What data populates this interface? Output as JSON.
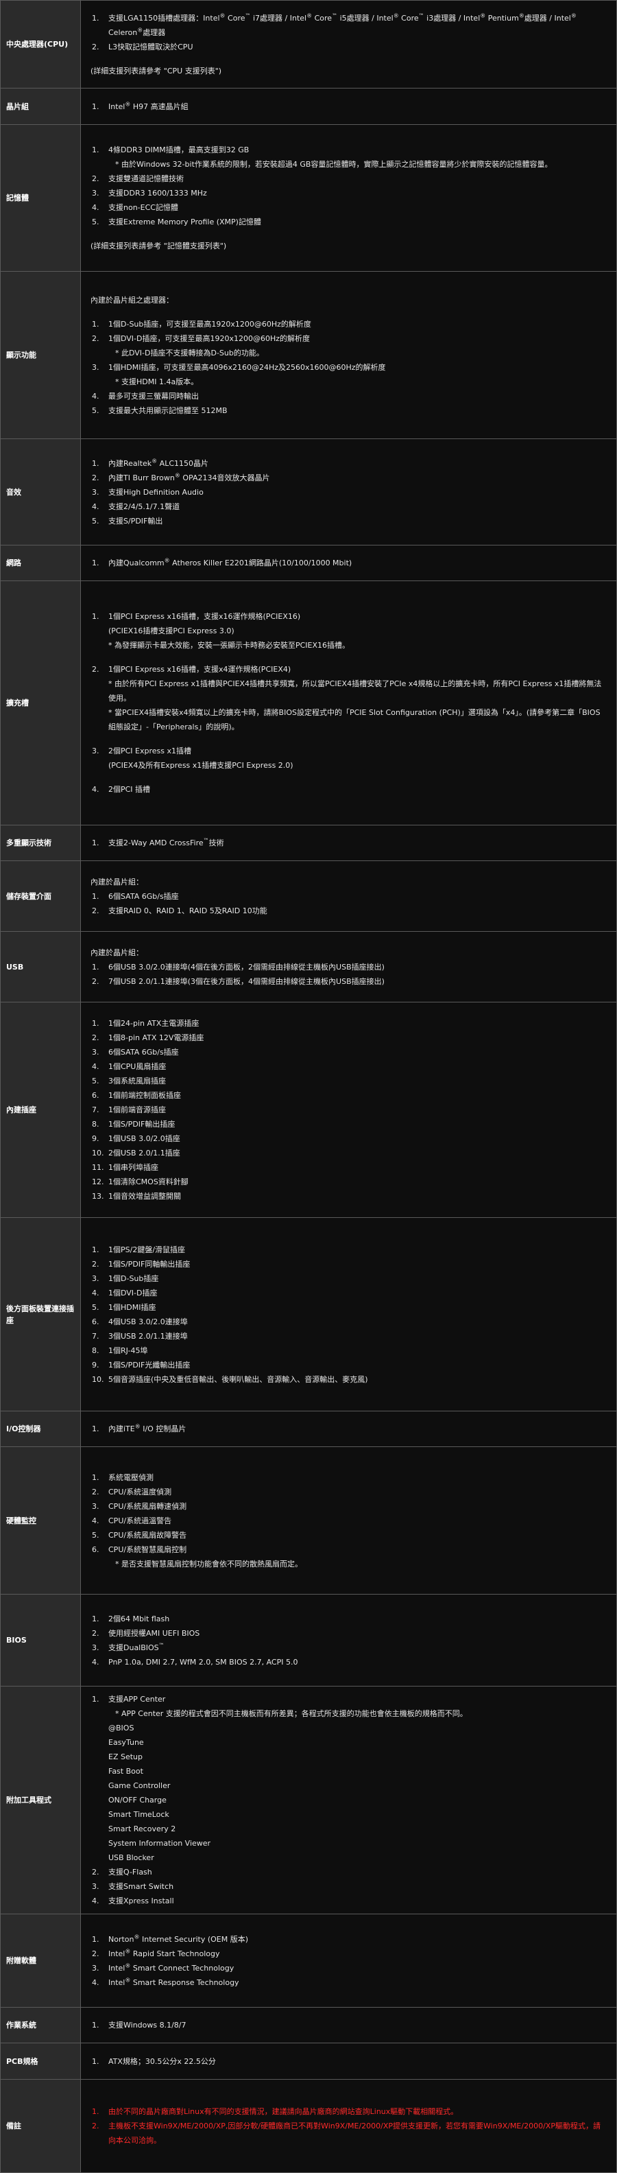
{
  "rows": [
    {
      "label": "中央處理器(CPU)",
      "lines": [
        {
          "t": "n",
          "num": "1.",
          "text": "支援LGA1150插槽處理器：Intel® Core™ i7處理器 / Intel® Core™ i5處理器 / Intel® Core™ i3處理器 / Intel® Pentium®處理器 / Intel® Celeron®處理器"
        },
        {
          "t": "n",
          "num": "2.",
          "text": "L3快取記憶體取決於CPU"
        },
        {
          "t": "blank"
        },
        {
          "t": "p",
          "text": "(詳細支援列表請參考 \"CPU 支援列表\")"
        }
      ]
    },
    {
      "label": "晶片組",
      "lines": [
        {
          "t": "n",
          "num": "1.",
          "text": "Intel® H97 高速晶片組"
        }
      ]
    },
    {
      "label": "記憶體",
      "lines": [
        {
          "t": "n",
          "num": "1.",
          "text": "4條DDR3 DIMM插槽，最高支援到32 GB"
        },
        {
          "t": "s",
          "text": "* 由於Windows 32-bit作業系統的限制，若安裝超過4 GB容量記憶體時，實際上顯示之記憶體容量將少於實際安裝的記憶體容量。"
        },
        {
          "t": "n",
          "num": "2.",
          "text": "支援雙通道記憶體技術"
        },
        {
          "t": "n",
          "num": "3.",
          "text": "支援DDR3 1600/1333 MHz"
        },
        {
          "t": "n",
          "num": "4.",
          "text": "支援non-ECC記憶體"
        },
        {
          "t": "n",
          "num": "5.",
          "text": "支援Extreme Memory Profile (XMP)記憶體"
        },
        {
          "t": "blank"
        },
        {
          "t": "p",
          "text": "(詳細支援列表請參考 \"記憶體支援列表\")"
        }
      ]
    },
    {
      "label": "顯示功能",
      "lines": [
        {
          "t": "p",
          "text": "內建於晶片組之處理器："
        },
        {
          "t": "blank"
        },
        {
          "t": "n",
          "num": "1.",
          "text": "1個D-Sub插座，可支援至最高1920x1200@60Hz的解析度"
        },
        {
          "t": "n",
          "num": "2.",
          "text": "1個DVI-D插座，可支援至最高1920x1200@60Hz的解析度"
        },
        {
          "t": "s",
          "text": "* 此DVI-D插座不支援轉接為D-Sub的功能。"
        },
        {
          "t": "n",
          "num": "3.",
          "text": "1個HDMI插座，可支援至最高4096x2160@24Hz及2560x1600@60Hz的解析度"
        },
        {
          "t": "s",
          "text": "* 支援HDMI 1.4a版本。"
        },
        {
          "t": "n",
          "num": "4.",
          "text": "最多可支援三螢幕同時輸出"
        },
        {
          "t": "n",
          "num": "5.",
          "text": "支援最大共用顯示記憶體至 512MB"
        }
      ]
    },
    {
      "label": "音效",
      "lines": [
        {
          "t": "n",
          "num": "1.",
          "text": "內建Realtek® ALC1150晶片"
        },
        {
          "t": "n",
          "num": "2.",
          "text": "內建TI Burr Brown® OPA2134音效放大器晶片"
        },
        {
          "t": "n",
          "num": "3.",
          "text": "支援High Definition Audio"
        },
        {
          "t": "n",
          "num": "4.",
          "text": "支援2/4/5.1/7.1聲道"
        },
        {
          "t": "n",
          "num": "5.",
          "text": "支援S/PDIF輸出"
        }
      ]
    },
    {
      "label": "網路",
      "lines": [
        {
          "t": "n",
          "num": "1.",
          "text": "內建Qualcomm® Atheros Killer E2201網路晶片(10/100/1000 Mbit)"
        }
      ]
    },
    {
      "label": "擴充槽",
      "lines": [
        {
          "t": "n",
          "num": "1.",
          "text": "1個PCI Express x16插槽，支援x16運作規格(PCIEX16)"
        },
        {
          "t": "i",
          "text": "(PCIEX16插槽支援PCI Express 3.0)"
        },
        {
          "t": "i",
          "text": "* 為發揮顯示卡最大效能，安裝一張顯示卡時務必安裝至PCIEX16插槽。"
        },
        {
          "t": "blank"
        },
        {
          "t": "n",
          "num": "2.",
          "text": "1個PCI Express x16插槽，支援x4運作規格(PCIEX4)"
        },
        {
          "t": "i",
          "text": "* 由於所有PCI Express x1插槽與PCIEX4插槽共享頻寬，所以當PCIEX4插槽安裝了PCIe x4規格以上的擴充卡時，所有PCI Express x1插槽將無法使用。"
        },
        {
          "t": "i",
          "text": "* 當PCIEX4插槽安裝x4頻寬以上的擴充卡時，請將BIOS設定程式中的「PCIE Slot Configuration (PCH)」選項設為「x4」。(請參考第二章「BIOS組態設定」-「Peripherals」的說明)。"
        },
        {
          "t": "blank"
        },
        {
          "t": "n",
          "num": "3.",
          "text": "2個PCI Express x1插槽"
        },
        {
          "t": "i",
          "text": "(PCIEX4及所有Express x1插槽支援PCI Express 2.0)"
        },
        {
          "t": "blank"
        },
        {
          "t": "n",
          "num": "4.",
          "text": "2個PCI 插槽"
        }
      ]
    },
    {
      "label": "多重顯示技術",
      "lines": [
        {
          "t": "n",
          "num": "1.",
          "text": "支援2-Way AMD CrossFire™技術"
        }
      ]
    },
    {
      "label": "儲存裝置介面",
      "lines": [
        {
          "t": "p",
          "text": "內建於晶片組："
        },
        {
          "t": "n",
          "num": "1.",
          "text": "6個SATA 6Gb/s插座"
        },
        {
          "t": "n",
          "num": "2.",
          "text": "支援RAID 0、RAID 1、RAID 5及RAID 10功能"
        }
      ]
    },
    {
      "label": "USB",
      "lines": [
        {
          "t": "p",
          "text": "內建於晶片組："
        },
        {
          "t": "n",
          "num": "1.",
          "text": "6個USB 3.0/2.0連接埠(4個在後方面板，2個需經由排線從主機板內USB插座接出)"
        },
        {
          "t": "n",
          "num": "2.",
          "text": "7個USB 2.0/1.1連接埠(3個在後方面板，4個需經由排線從主機板內USB插座接出)"
        }
      ]
    },
    {
      "label": "內建插座",
      "lines": [
        {
          "t": "n",
          "num": "1.",
          "text": "1個24-pin ATX主電源插座"
        },
        {
          "t": "n",
          "num": "2.",
          "text": "1個8-pin ATX 12V電源插座"
        },
        {
          "t": "n",
          "num": "3.",
          "text": "6個SATA 6Gb/s插座"
        },
        {
          "t": "n",
          "num": "4.",
          "text": "1個CPU風扇插座"
        },
        {
          "t": "n",
          "num": "5.",
          "text": "3個系統風扇插座"
        },
        {
          "t": "n",
          "num": "6.",
          "text": "1個前端控制面板插座"
        },
        {
          "t": "n",
          "num": "7.",
          "text": "1個前端音源插座"
        },
        {
          "t": "n",
          "num": "8.",
          "text": "1個S/PDIF輸出插座"
        },
        {
          "t": "n",
          "num": "9.",
          "text": "1個USB 3.0/2.0插座"
        },
        {
          "t": "n",
          "num": "10.",
          "text": "2個USB 2.0/1.1插座"
        },
        {
          "t": "n",
          "num": "11.",
          "text": "1個串列埠插座"
        },
        {
          "t": "n",
          "num": "12.",
          "text": "1個清除CMOS資料針腳"
        },
        {
          "t": "n",
          "num": "13.",
          "text": "1個音效增益調整開關"
        }
      ]
    },
    {
      "label": "後方面板裝置連接插座",
      "lines": [
        {
          "t": "n",
          "num": "1.",
          "text": "1個PS/2鍵盤/滑鼠插座"
        },
        {
          "t": "n",
          "num": "2.",
          "text": "1個S/PDIF同軸輸出插座"
        },
        {
          "t": "n",
          "num": "3.",
          "text": "1個D-Sub插座"
        },
        {
          "t": "n",
          "num": "4.",
          "text": "1個DVI-D插座"
        },
        {
          "t": "n",
          "num": "5.",
          "text": "1個HDMI插座"
        },
        {
          "t": "n",
          "num": "6.",
          "text": "4個USB 3.0/2.0連接埠"
        },
        {
          "t": "n",
          "num": "7.",
          "text": "3個USB 2.0/1.1連接埠"
        },
        {
          "t": "n",
          "num": "8.",
          "text": "1個RJ-45埠"
        },
        {
          "t": "n",
          "num": "9.",
          "text": "1個S/PDIF光纖輸出插座"
        },
        {
          "t": "n",
          "num": "10.",
          "text": "5個音源插座(中央及重低音輸出、後喇叭輸出、音源輸入、音源輸出、麥克風)"
        }
      ]
    },
    {
      "label": "I/O控制器",
      "lines": [
        {
          "t": "n",
          "num": "1.",
          "text": "內建iTE® I/O 控制晶片"
        }
      ]
    },
    {
      "label": "硬體監控",
      "lines": [
        {
          "t": "n",
          "num": "1.",
          "text": "系統電壓偵測"
        },
        {
          "t": "n",
          "num": "2.",
          "text": "CPU/系統溫度偵測"
        },
        {
          "t": "n",
          "num": "3.",
          "text": "CPU/系統風扇轉速偵測"
        },
        {
          "t": "n",
          "num": "4.",
          "text": "CPU/系統過溫警告"
        },
        {
          "t": "n",
          "num": "5.",
          "text": "CPU/系統風扇故障警告"
        },
        {
          "t": "n",
          "num": "6.",
          "text": "CPU/系統智慧風扇控制"
        },
        {
          "t": "s",
          "text": "* 是否支援智慧風扇控制功能會依不同的散熱風扇而定。"
        }
      ]
    },
    {
      "label": "BIOS",
      "lines": [
        {
          "t": "n",
          "num": "1.",
          "text": "2個64 Mbit flash"
        },
        {
          "t": "n",
          "num": "2.",
          "text": "使用經授權AMI UEFI BIOS"
        },
        {
          "t": "n",
          "num": "3.",
          "text": "支援DualBIOS™"
        },
        {
          "t": "n",
          "num": "4.",
          "text": "PnP 1.0a, DMI 2.7, WfM 2.0, SM BIOS 2.7, ACPI 5.0"
        }
      ]
    },
    {
      "label": "附加工具程式",
      "lines": [
        {
          "t": "n",
          "num": "1.",
          "text": "支援APP Center"
        },
        {
          "t": "s",
          "text": "* APP Center 支援的程式會因不同主機板而有所差異；各程式所支援的功能也會依主機板的規格而不同。"
        },
        {
          "t": "i",
          "text": "@BIOS"
        },
        {
          "t": "i",
          "text": "EasyTune"
        },
        {
          "t": "i",
          "text": "EZ Setup"
        },
        {
          "t": "i",
          "text": "Fast Boot"
        },
        {
          "t": "i",
          "text": "Game Controller"
        },
        {
          "t": "i",
          "text": "ON/OFF Charge"
        },
        {
          "t": "i",
          "text": "Smart TimeLock"
        },
        {
          "t": "i",
          "text": "Smart Recovery 2"
        },
        {
          "t": "i",
          "text": "System Information Viewer"
        },
        {
          "t": "i",
          "text": "USB Blocker"
        },
        {
          "t": "n",
          "num": "2.",
          "text": "支援Q-Flash"
        },
        {
          "t": "n",
          "num": "3.",
          "text": "支援Smart Switch"
        },
        {
          "t": "n",
          "num": "4.",
          "text": "支援Xpress Install"
        }
      ]
    },
    {
      "label": "附贈軟體",
      "lines": [
        {
          "t": "n",
          "num": "1.",
          "text": "Norton® Internet Security (OEM 版本)"
        },
        {
          "t": "n",
          "num": "2.",
          "text": "Intel® Rapid Start Technology"
        },
        {
          "t": "n",
          "num": "3.",
          "text": "Intel® Smart Connect Technology"
        },
        {
          "t": "n",
          "num": "4.",
          "text": "Intel® Smart Response Technology"
        }
      ]
    },
    {
      "label": "作業系統",
      "lines": [
        {
          "t": "n",
          "num": "1.",
          "text": "支援Windows 8.1/8/7"
        }
      ]
    },
    {
      "label": "PCB規格",
      "lines": [
        {
          "t": "n",
          "num": "1.",
          "text": "ATX規格；30.5公分x 22.5公分"
        }
      ]
    },
    {
      "label": "備註",
      "lines": [
        {
          "t": "n",
          "num": "1.",
          "text": "由於不同的晶片廠商對Linux有不同的支援情況，建議請向晶片廠商的網站查詢Linux驅動下載相關程式。",
          "color": "#ff2a2a"
        },
        {
          "t": "n",
          "num": "2.",
          "text": "主機板不支援Win9X/ME/2000/XP,因部分軟/硬體廠商已不再對Win9X/ME/2000/XP提供支援更新，若您有需要Win9X/ME/2000/XP驅動程式，請向本公司洽詢。",
          "color": "#ff2a2a"
        }
      ]
    }
  ]
}
